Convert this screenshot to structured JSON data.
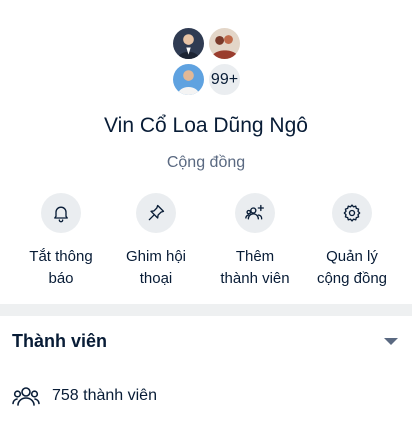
{
  "group": {
    "name": "Vin Cổ Loa Dũng Ngô",
    "type": "Cộng đồng",
    "avatars": {
      "more_count": "99+"
    }
  },
  "actions": [
    {
      "icon": "bell-icon",
      "line1": "Tắt thông",
      "line2": "báo"
    },
    {
      "icon": "pin-icon",
      "line1": "Ghim hội",
      "line2": "thoại"
    },
    {
      "icon": "add-member-icon",
      "line1": "Thêm",
      "line2": "thành viên"
    },
    {
      "icon": "gear-icon",
      "line1": "Quản lý",
      "line2": "cộng đồng"
    }
  ],
  "members_section": {
    "title": "Thành viên",
    "count_text": "758 thành viên"
  },
  "colors": {
    "text": "#081c36",
    "muted": "#5a6981",
    "icon_bg": "#eaedf0",
    "divider": "#eef0f1"
  }
}
